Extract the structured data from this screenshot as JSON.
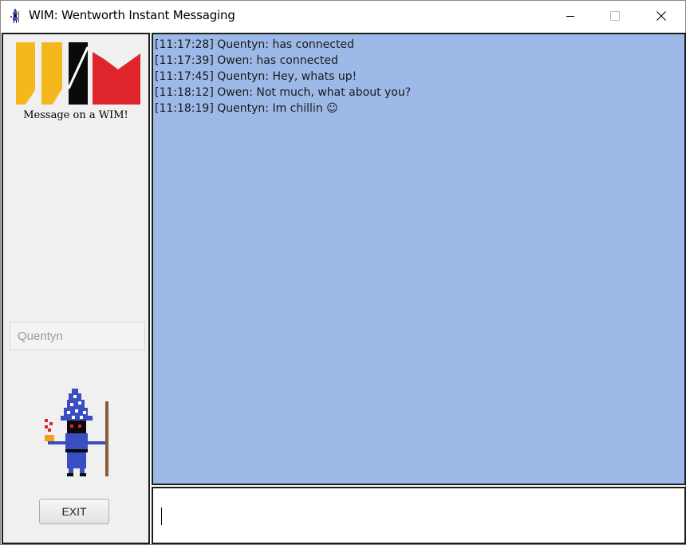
{
  "window": {
    "title": "WIM: Wentworth Instant Messaging",
    "icon": "wizard-app-icon",
    "controls": [
      "minimize-icon",
      "maximize-icon",
      "close-icon"
    ]
  },
  "sidebar": {
    "logo_text": "WIM",
    "logo_colors": [
      "#f5b81c",
      "#000000",
      "#e0242b"
    ],
    "tagline": "Message on a WIM!",
    "username_value": "Quentyn",
    "exit_label": "EXIT"
  },
  "chat": {
    "background": "#9db9e8",
    "messages": [
      "[11:17:28] Quentyn: has connected",
      "[11:17:39] Owen: has connected",
      "[11:17:45] Quentyn: Hey, whats up!",
      "[11:18:12] Owen: Not much, what about you?",
      "[11:18:19] Quentyn: Im chillin ☺"
    ]
  },
  "composer": {
    "value": ""
  }
}
